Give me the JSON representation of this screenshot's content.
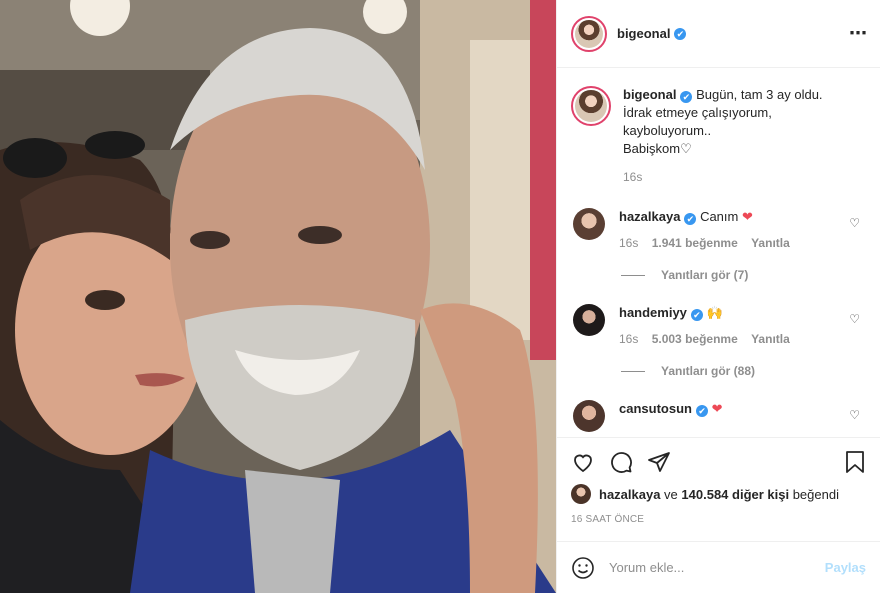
{
  "post": {
    "username": "bigeonal",
    "verified_mark": "✔",
    "more_icon": "⋯",
    "caption_lines": [
      "Bugün, tam 3 ay oldu.",
      "İdrak etmeye çalışıyorum,",
      "kayboluyorum..",
      "Babişkom♡"
    ],
    "caption_time": "16s",
    "comments": [
      {
        "user": "hazalkaya",
        "text": "Canım",
        "emoji": "❤",
        "time": "16s",
        "likes": "1.941 beğenme",
        "reply": "Yanıtla",
        "view_replies": "Yanıtları gör (7)",
        "avatar_color": "#7a5a48"
      },
      {
        "user": "handemiyy",
        "text": "",
        "emoji": "🙌",
        "time": "16s",
        "likes": "5.003 beğenme",
        "reply": "Yanıtla",
        "view_replies": "Yanıtları gör (88)",
        "avatar_color": "#2e2a2a"
      },
      {
        "user": "cansutosun",
        "text": "",
        "emoji": "❤",
        "avatar_color": "#5c4238"
      }
    ],
    "liked_by_user": "hazalkaya",
    "liked_by_rest": " ve ",
    "liked_by_count": "140.584 diğer kişi",
    "liked_by_suffix": " beğendi",
    "posted_ago": "16 SAAT ÖNCE",
    "comment_placeholder": "Yorum ekle...",
    "post_button": "Paylaş",
    "like_icon": "heart-outline-icon",
    "comment_icon": "comment-icon",
    "share_icon": "paper-plane-icon",
    "save_icon": "bookmark-icon",
    "emoji_icon": "smiley-icon",
    "comment_like_icon": "♡"
  }
}
